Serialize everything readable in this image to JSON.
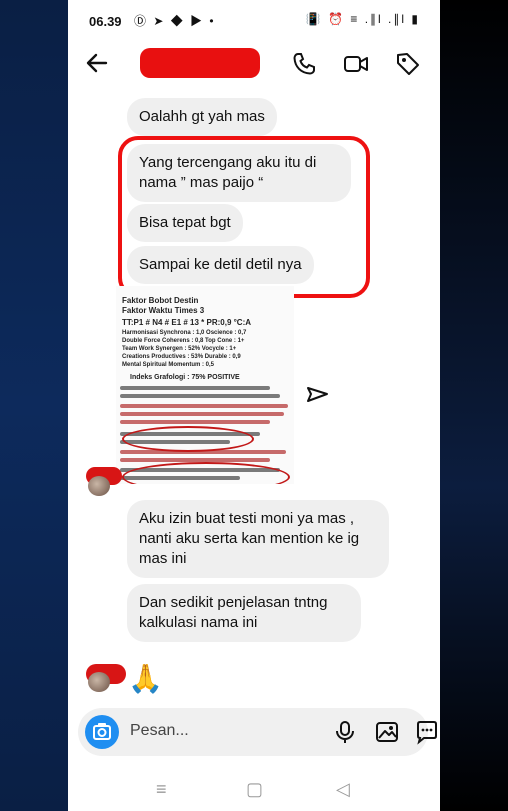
{
  "status_bar": {
    "time": "06.39",
    "app_icons": "Ⓓ ➤ ◆ ▶ •",
    "system_icons": "📳 ⏰ ≡ .∥l .∥l ▮"
  },
  "header": {
    "back_icon": "arrow-left",
    "contact_name": "",
    "actions": [
      "phone-icon",
      "video-icon",
      "tag-icon"
    ]
  },
  "messages_top": [
    {
      "text": "Oalahh gt yah mas"
    },
    {
      "text": "Yang tercengang aku itu di nama ” mas paijo “"
    },
    {
      "text": "Bisa tepat bgt"
    },
    {
      "text": "Sampai ke detil detil nya"
    }
  ],
  "attachment": {
    "lines": [
      "Faktor Bobot  Destin",
      "Faktor Waktu  Times 3",
      "TT:P1 # N4 # E1 # 13 * PR:0,9 °C:A",
      "Harmonisasi  Synchrona : 1,0   Oscience : 0,7",
      "Double Force  Coherens : 0,8   Top Cone : 1+",
      "Team Work  Synergen : 52%   Vocycle : 1+",
      "Creations  Productives : 53%  Durable : 0,9",
      "Mental Spiritual  Momentum : 0,5",
      "Indeks Grafologi : 75%  POSITIVE"
    ]
  },
  "messages_bottom": [
    {
      "text": "Aku izin buat testi moni ya mas , nanti aku serta kan mention ke ig mas ini"
    },
    {
      "text": "Dan sedikit penjelasan tntng kalkulasi nama ini"
    }
  ],
  "reaction": {
    "emoji": "🙏"
  },
  "input": {
    "placeholder": "Pesan..."
  },
  "nav": {
    "menu": "≡",
    "home": "▢",
    "back": "◁"
  }
}
